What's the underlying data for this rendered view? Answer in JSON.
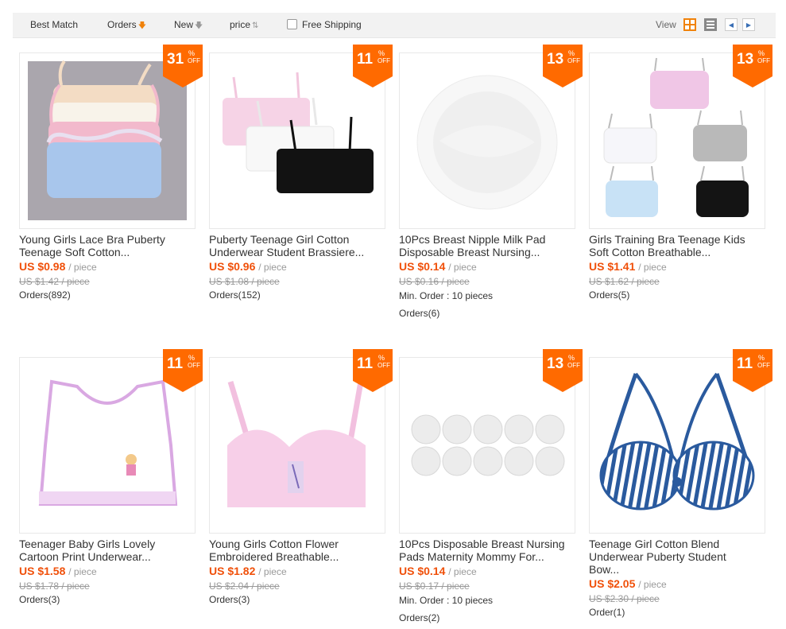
{
  "sort_bar": {
    "best_match": "Best Match",
    "orders": "Orders",
    "new": "New",
    "price": "price",
    "free_shipping": "Free Shipping",
    "view_label": "View"
  },
  "colors": {
    "accent": "#f0820a",
    "price": "#f0500a",
    "badge": "#ff6a00"
  },
  "products": [
    {
      "discount": "31",
      "pct": "%",
      "off": "OFF",
      "title_line1": "Young Girls Lace Bra Puberty",
      "title_line2": "Teenage Soft Cotton...",
      "title_line3": "",
      "price": "US $0.98",
      "unit": "/ piece",
      "old_price": "US $1.42 / piece",
      "min_order": "",
      "orders": "Orders(892)",
      "image": "lace-bras-stack"
    },
    {
      "discount": "11",
      "pct": "%",
      "off": "OFF",
      "title_line1": "Puberty Teenage Girl Cotton",
      "title_line2": "Underwear Student Brassiere...",
      "title_line3": "",
      "price": "US $0.96",
      "unit": "/ piece",
      "old_price": "US $1.08 / piece",
      "min_order": "",
      "orders": "Orders(152)",
      "image": "three-bras"
    },
    {
      "discount": "13",
      "pct": "%",
      "off": "OFF",
      "title_line1": "10Pcs Breast Nipple Milk Pad",
      "title_line2": "Disposable Breast Nursing...",
      "title_line3": "",
      "price": "US $0.14",
      "unit": "/ piece",
      "old_price": "US $0.16 / piece",
      "min_order": "Min. Order : 10 pieces",
      "orders": "Orders(6)",
      "image": "nursing-pad"
    },
    {
      "discount": "13",
      "pct": "%",
      "off": "OFF",
      "title_line1": "Girls Training Bra Teenage Kids",
      "title_line2": "Soft Cotton Breathable...",
      "title_line3": "",
      "price": "US $1.41",
      "unit": "/ piece",
      "old_price": "US $1.62 / piece",
      "min_order": "",
      "orders": "Orders(5)",
      "image": "five-bras"
    },
    {
      "discount": "11",
      "pct": "%",
      "off": "OFF",
      "title_line1": "Teenager Baby Girls Lovely",
      "title_line2": "Cartoon Print Underwear...",
      "title_line3": "",
      "price": "US $1.58",
      "unit": "/ piece",
      "old_price": "US $1.78 / piece",
      "min_order": "",
      "orders": "Orders(3)",
      "image": "white-crop-top"
    },
    {
      "discount": "11",
      "pct": "%",
      "off": "OFF",
      "title_line1": "Young Girls Cotton Flower",
      "title_line2": "Embroidered Breathable...",
      "title_line3": "",
      "price": "US $1.82",
      "unit": "/ piece",
      "old_price": "US $2.04 / piece",
      "min_order": "",
      "orders": "Orders(3)",
      "image": "pink-bra"
    },
    {
      "discount": "13",
      "pct": "%",
      "off": "OFF",
      "title_line1": "10Pcs Disposable Breast Nursing",
      "title_line2": "Pads Maternity Mommy For...",
      "title_line3": "",
      "price": "US $0.14",
      "unit": "/ piece",
      "old_price": "US $0.17 / piece",
      "min_order": "Min. Order : 10 pieces",
      "orders": "Orders(2)",
      "image": "ten-pads"
    },
    {
      "discount": "11",
      "pct": "%",
      "off": "OFF",
      "title_line1": "Teenage Girl Cotton Blend",
      "title_line2": "Underwear Puberty Student",
      "title_line3": "Bow...",
      "price": "US $2.05",
      "unit": "/ piece",
      "old_price": "US $2.30 / piece",
      "min_order": "",
      "orders": "Order(1)",
      "image": "striped-bra"
    }
  ]
}
